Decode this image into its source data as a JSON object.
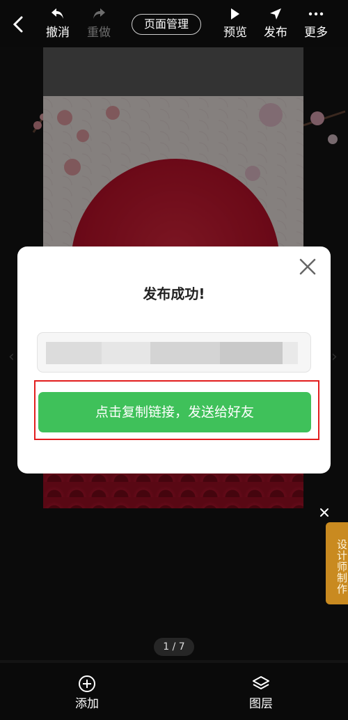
{
  "toolbar": {
    "undo_label": "撤消",
    "redo_label": "重做",
    "page_manage_label": "页面管理",
    "preview_label": "预览",
    "publish_label": "发布",
    "more_label": "更多"
  },
  "modal": {
    "title": "发布成功!",
    "copy_button_label": "点击复制链接，发送给好友"
  },
  "designer_tab": {
    "label": "设计师制作"
  },
  "page_indicator": "1 / 7",
  "bottom": {
    "add_label": "添加",
    "layers_label": "图层"
  },
  "colors": {
    "accent_green": "#3fc15a",
    "highlight_red": "#e21d1d",
    "designer_orange": "#c98a20"
  }
}
